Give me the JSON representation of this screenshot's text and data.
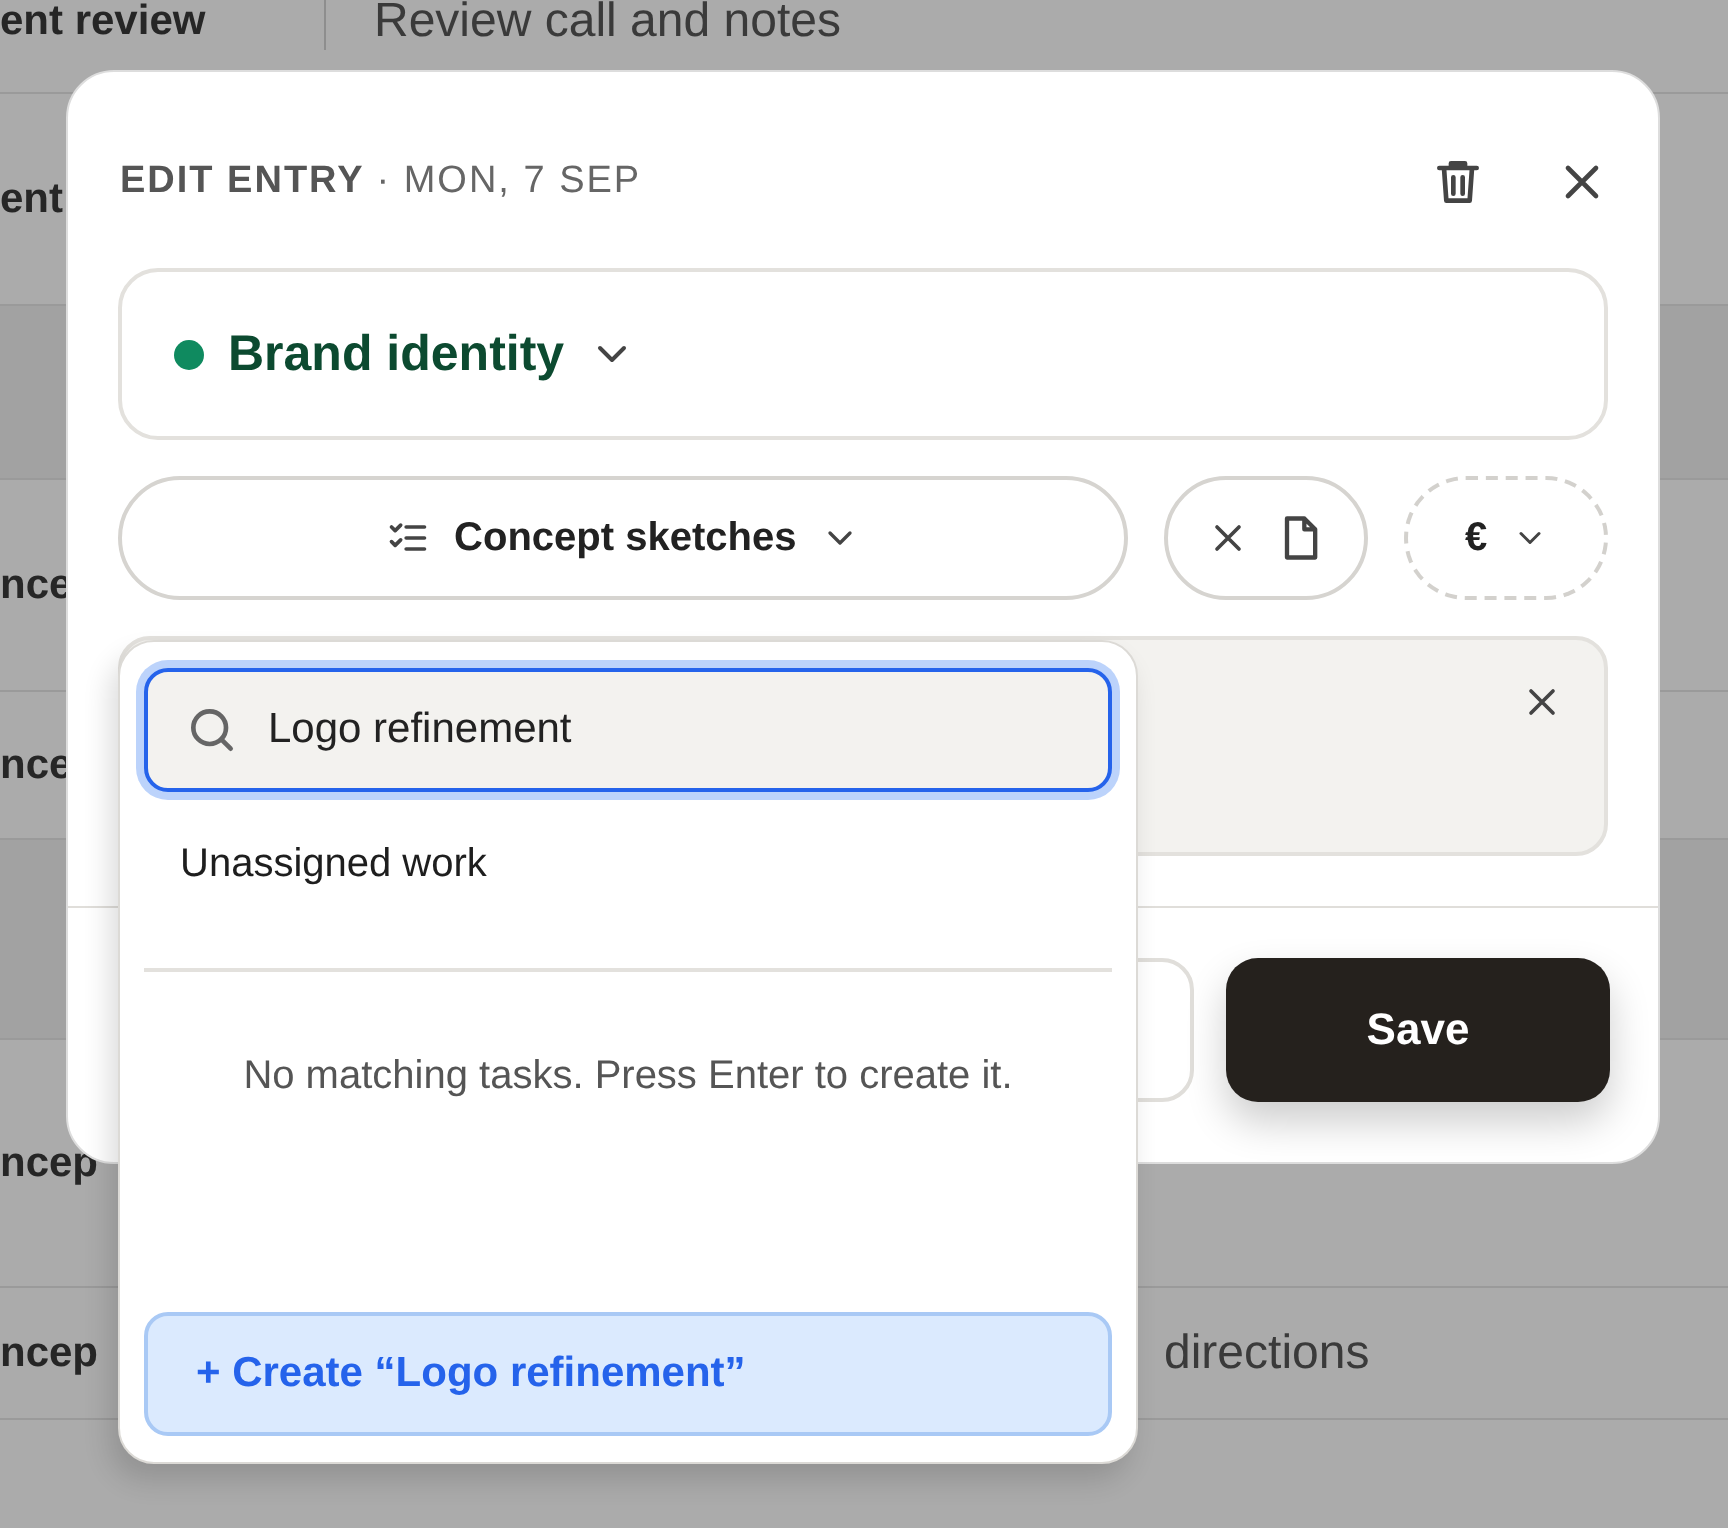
{
  "background_table": {
    "rows": [
      {
        "kind": "row",
        "column_1": "ent review",
        "column_2": "Review call and notes"
      },
      {
        "kind": "row",
        "column_1": "ent",
        "column_2": ""
      },
      {
        "kind": "band"
      },
      {
        "kind": "row",
        "column_1": "nce",
        "column_2": ""
      },
      {
        "kind": "row",
        "column_1": "nce",
        "column_2": ""
      },
      {
        "kind": "band"
      },
      {
        "kind": "row",
        "column_1": "ncep",
        "column_2": ""
      },
      {
        "kind": "row",
        "column_1": "ncep",
        "column_2": "directions"
      }
    ]
  },
  "dialog": {
    "title": "EDIT ENTRY",
    "date": "· MON, 7 SEP",
    "project": {
      "name": "Brand identity",
      "color": "#0f8a5f"
    },
    "task": {
      "label": "Concept sketches"
    },
    "currency": {
      "symbol": "€"
    },
    "save_button": "Save"
  },
  "task_dropdown": {
    "search": {
      "value": "Logo refinement"
    },
    "options": [
      {
        "label": "Unassigned work"
      }
    ],
    "empty_message": "No matching tasks. Press Enter to create it.",
    "create_button": "+ Create “Logo refinement”"
  }
}
